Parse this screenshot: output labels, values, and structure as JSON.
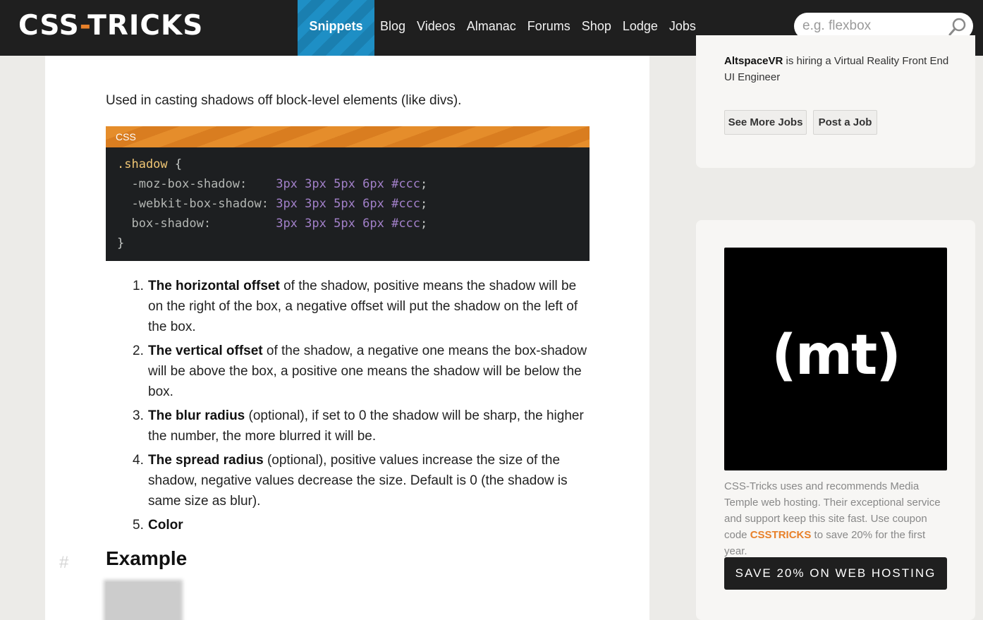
{
  "header": {
    "logo_left": "CSS",
    "logo_dash": "-",
    "logo_right": "TRICKS",
    "nav": [
      "Snippets",
      "Blog",
      "Videos",
      "Almanac",
      "Forums",
      "Shop",
      "Lodge",
      "Jobs"
    ],
    "active_nav": "Snippets",
    "search_placeholder": "e.g. flexbox"
  },
  "article": {
    "intro": "Used in casting shadows off block-level elements (like divs).",
    "code_lang": "CSS",
    "code": {
      "selector": ".shadow",
      "open_brace": "{",
      "close_brace": "}",
      "lines": [
        {
          "prop": "-moz-box-shadow:",
          "pad": "    ",
          "value": [
            "3px",
            "3px",
            "5px",
            "6px",
            "#ccc"
          ]
        },
        {
          "prop": "-webkit-box-shadow:",
          "pad": " ",
          "value": [
            "3px",
            "3px",
            "5px",
            "6px",
            "#ccc"
          ]
        },
        {
          "prop": "box-shadow:",
          "pad": "         ",
          "value": [
            "3px",
            "3px",
            "5px",
            "6px",
            "#ccc"
          ]
        }
      ]
    },
    "steps": [
      {
        "num": "1.",
        "bold": "The horizontal offset",
        "text": " of the shadow, positive means the shadow will be on the right of the box, a negative offset will put the shadow on the left of the box."
      },
      {
        "num": "2.",
        "bold": "The vertical offset",
        "text": " of the shadow, a negative one means the box-shadow will be above the box, a positive one means the shadow will be below the box."
      },
      {
        "num": "3.",
        "bold": "The blur radius",
        "text": " (optional), if set to 0 the shadow will be sharp, the higher the number, the more blurred it will be."
      },
      {
        "num": "4.",
        "bold": "The spread radius",
        "text": " (optional), positive values increase the size of the shadow, negative values decrease the size. Default is 0 (the shadow is same size as blur)."
      },
      {
        "num": "5.",
        "bold": "Color",
        "text": ""
      }
    ],
    "example_anchor": "#",
    "example_heading": "Example"
  },
  "sidebar": {
    "job_company": "AltspaceVR",
    "job_text": " is hiring a Virtual Reality Front End UI Engineer",
    "see_more_jobs": "See More Jobs",
    "post_job": "Post a Job",
    "ad_logo_text": "(mt)",
    "ad_text_before": "CSS-Tricks uses and recommends Media Temple web hosting. Their exceptional service and support keep this site fast. Use coupon code ",
    "ad_coupon": "CSSTRICKS",
    "ad_text_after": " to save 20% for the first year.",
    "ad_button": "SAVE 20% ON WEB HOSTING"
  },
  "colors": {
    "header_bg": "#1f1f1f",
    "active_nav_bg": "#1e8fc5",
    "accent_orange": "#e8812a",
    "code_bg": "#1d1f21"
  },
  "icons": [
    "search-icon"
  ]
}
